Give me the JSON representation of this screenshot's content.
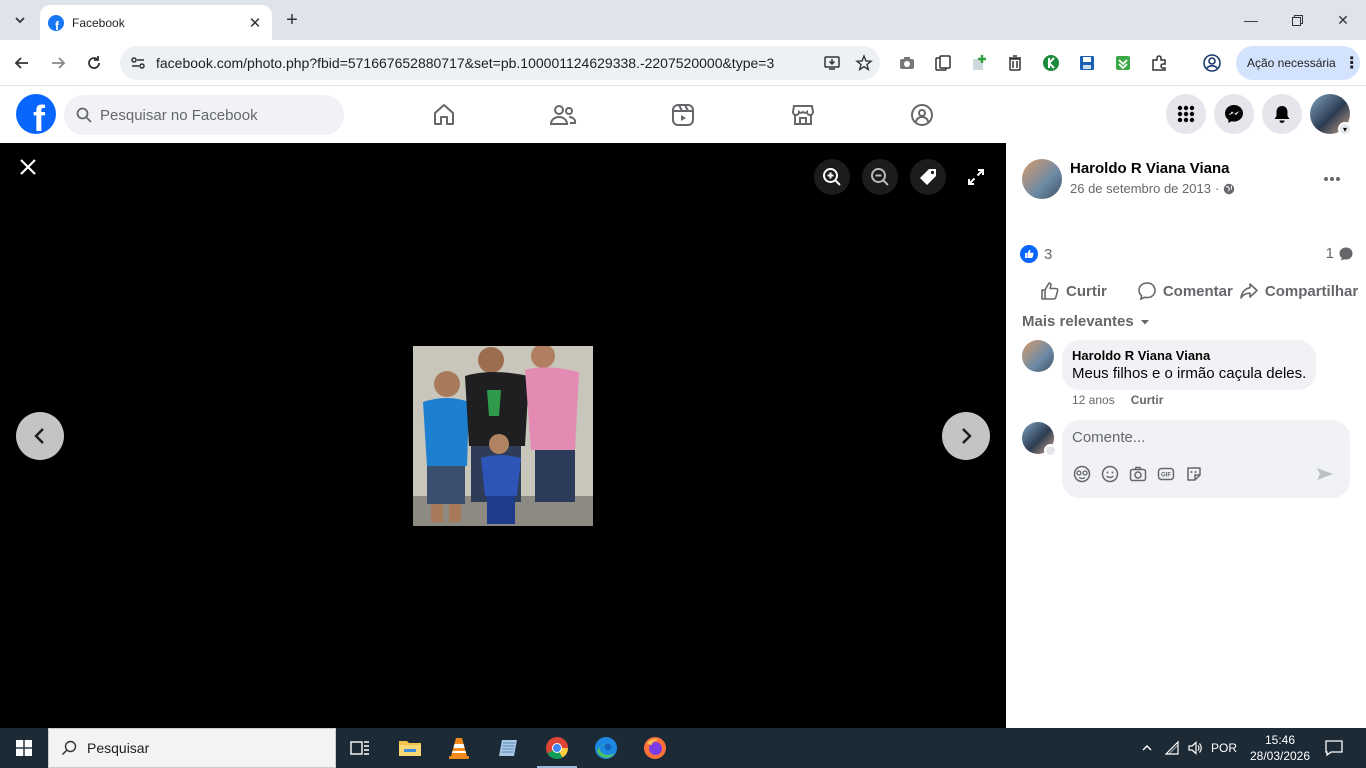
{
  "browser": {
    "tab_title": "Facebook",
    "url": "facebook.com/photo.php?fbid=571667652880717&set=pb.100001124629338.-2207520000&type=3",
    "action_needed": "Ação necessária"
  },
  "fb_header": {
    "search_placeholder": "Pesquisar no Facebook",
    "logo_letter": "f"
  },
  "post": {
    "author": "Haroldo R Viana Viana",
    "date": "26 de setembro de 2013",
    "date_separator": "·",
    "reactions_count": "3",
    "comments_count": "1",
    "actions": {
      "like": "Curtir",
      "comment": "Comentar",
      "share": "Compartilhar"
    },
    "sort_label": "Mais relevantes"
  },
  "comment": {
    "author": "Haroldo R Viana Viana",
    "text": "Meus filhos e o irmão caçula deles.",
    "age": "12 anos",
    "like": "Curtir"
  },
  "composer": {
    "placeholder": "Comente..."
  },
  "taskbar": {
    "search_label": "Pesquisar",
    "language": "POR",
    "time": "15:46",
    "date": "28/03/2026"
  },
  "colors": {
    "fb_blue": "#0866ff",
    "viewer_bg": "#000000",
    "panel_bg": "#ffffff",
    "taskbar_bg": "#1c2a36"
  }
}
